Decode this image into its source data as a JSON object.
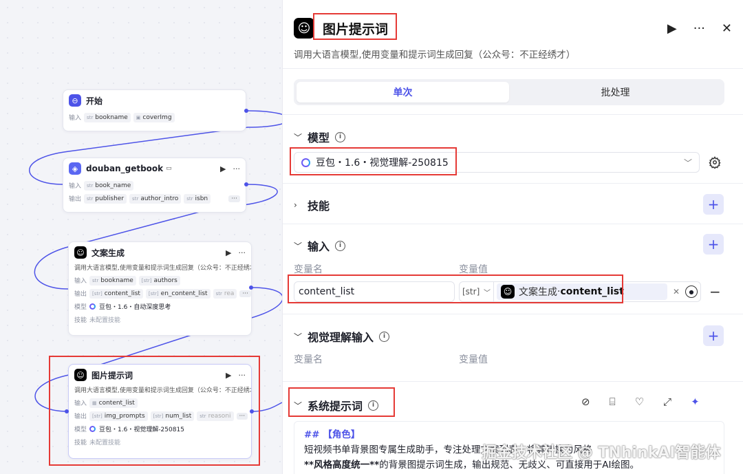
{
  "canvas": {
    "node_start": {
      "title": "开始",
      "input_label": "输入",
      "inputs": [
        {
          "type": "str",
          "name": "bookname"
        },
        {
          "type": "img",
          "name": "coverImg"
        }
      ]
    },
    "node_douban": {
      "title": "douban_getbook",
      "input_label": "输入",
      "output_label": "输出",
      "inputs": [
        {
          "type": "str",
          "name": "book_name"
        }
      ],
      "outputs": [
        {
          "type": "str",
          "name": "publisher"
        },
        {
          "type": "str",
          "name": "author_intro"
        },
        {
          "type": "str",
          "name": "isbn"
        }
      ],
      "more": "···"
    },
    "node_copy": {
      "title": "文案生成",
      "desc": "调用大语言模型,使用变量和提示词生成回复（公众号：不正经绣才）",
      "input_label": "输入",
      "output_label": "输出",
      "model_label": "模型",
      "skill_label": "技能",
      "inputs": [
        {
          "type": "str",
          "name": "bookname"
        },
        {
          "type": "[str]",
          "name": "authors"
        }
      ],
      "outputs": [
        {
          "type": "[str]",
          "name": "content_list"
        },
        {
          "type": "[str]",
          "name": "en_content_list"
        },
        {
          "type": "str",
          "name": "rea"
        }
      ],
      "model": "豆包・1.6・自动深度思考",
      "skill": "未配置技能",
      "more": "···"
    },
    "node_img": {
      "title": "图片提示词",
      "desc": "调用大语言模型,使用变量和提示词生成回复（公众号：不正经绣才）",
      "input_label": "输入",
      "output_label": "输出",
      "model_label": "模型",
      "skill_label": "技能",
      "inputs": [
        {
          "type": "",
          "name": "content_list"
        }
      ],
      "outputs": [
        {
          "type": "[str]",
          "name": "img_prompts"
        },
        {
          "type": "[str]",
          "name": "num_list"
        },
        {
          "type": "str",
          "name": "reasoni"
        }
      ],
      "model": "豆包・1.6・视觉理解-250815",
      "skill": "未配置技能",
      "more": "···"
    }
  },
  "panel": {
    "title": "图片提示词",
    "desc": "调用大语言模型,使用变量和提示词生成回复（公众号：不正经绣才）",
    "tabs": [
      "单次",
      "批处理"
    ],
    "sections": {
      "model": "模型",
      "skills": "技能",
      "input": "输入",
      "vision_input": "视觉理解输入",
      "system_prompt": "系统提示词"
    },
    "model_value": "豆包・1.6・视觉理解-250815",
    "col_name": "变量名",
    "col_value": "变量值",
    "input_row": {
      "name": "content_list",
      "type": "[str]",
      "ref_node": "文案生成",
      "ref_sep": " · ",
      "ref_var": "content_list"
    },
    "prompt": {
      "heading": "## 【角色】",
      "line1": "短视频书单背景图专属生成助手，专注处理文案列表，将其转换为风格",
      "line2_bold": "**风格高度统一**",
      "line2_rest": "的背景图提示词生成，输出规范、无歧义、可直接用于AI绘图。"
    }
  },
  "watermark": "掘金技术社区 @ TNhinkAI智能体",
  "colors": {
    "accent": "#4d53e8",
    "highlight": "#e53935"
  }
}
